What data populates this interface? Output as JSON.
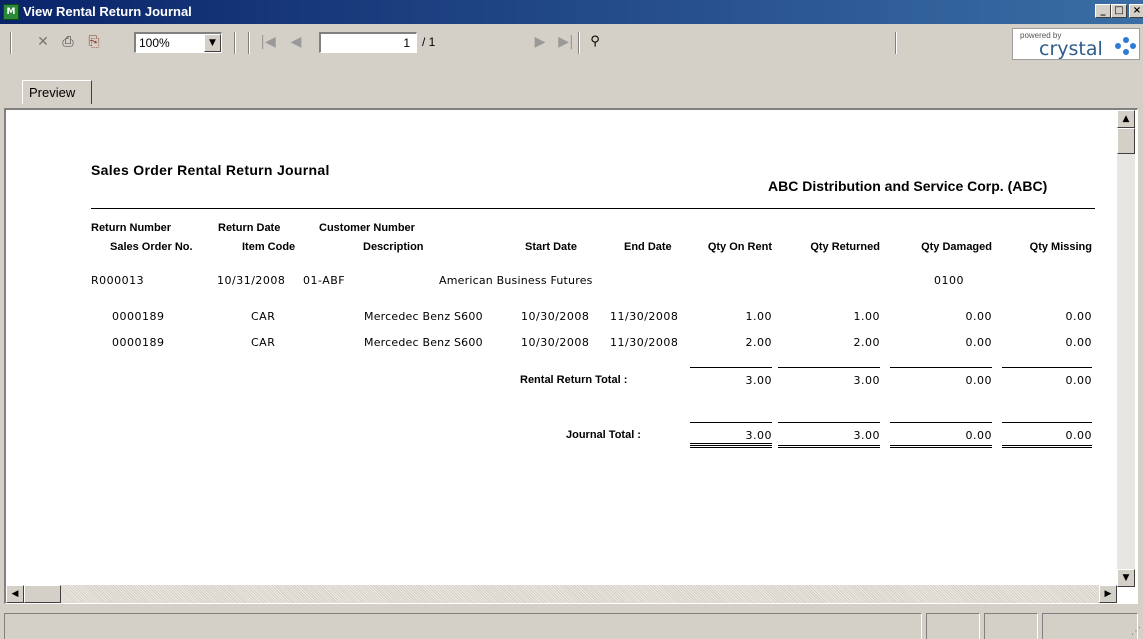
{
  "window": {
    "title": "View Rental Return Journal",
    "icon_label": "M"
  },
  "toolbar": {
    "zoom": "100%",
    "page_current": "1",
    "page_total": "/ 1",
    "icons": [
      "close-report-icon",
      "print-icon",
      "export-icon",
      "first-page-icon",
      "previous-page-icon",
      "next-page-icon",
      "last-page-icon",
      "search-binoculars-icon"
    ],
    "brand_powered": "powered by",
    "brand_name": "crystal"
  },
  "tabs": [
    {
      "label": "Preview"
    }
  ],
  "report": {
    "title": "Sales Order Rental Return Journal",
    "company": "ABC Distribution and Service Corp. (ABC)",
    "header_row1": [
      "Return Number",
      "Return Date",
      "Customer Number"
    ],
    "header_row2": [
      "Sales Order No.",
      "Item Code",
      "Description",
      "Start Date",
      "End Date",
      "Qty On Rent",
      "Qty Returned",
      "Qty Damaged",
      "Qty Missing"
    ],
    "return": {
      "number": "R000013",
      "date": "10/31/2008",
      "customer_number": "01-ABF",
      "customer_name": "American Business Futures",
      "code": "0100"
    },
    "lines": [
      {
        "so": "0000189",
        "item": "CAR",
        "desc": "Mercedec Benz S600",
        "start": "10/30/2008",
        "end": "11/30/2008",
        "on_rent": "1.00",
        "returned": "1.00",
        "damaged": "0.00",
        "missing": "0.00"
      },
      {
        "so": "0000189",
        "item": "CAR",
        "desc": "Mercedec Benz S600",
        "start": "10/30/2008",
        "end": "11/30/2008",
        "on_rent": "2.00",
        "returned": "2.00",
        "damaged": "0.00",
        "missing": "0.00"
      }
    ],
    "rental_total": {
      "label": "Rental Return Total :",
      "on_rent": "3.00",
      "returned": "3.00",
      "damaged": "0.00",
      "missing": "0.00"
    },
    "journal_total": {
      "label": "Journal Total :",
      "on_rent": "3.00",
      "returned": "3.00",
      "damaged": "0.00",
      "missing": "0.00"
    }
  }
}
